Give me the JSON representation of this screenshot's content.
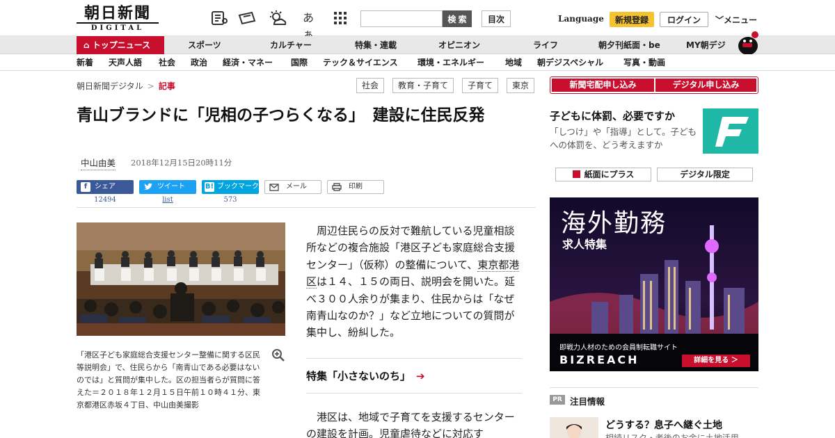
{
  "header": {
    "logo_main": "朝日新聞",
    "logo_sub": "DIGITAL",
    "font_size_label": "あぁ",
    "search_placeholder": "",
    "search_button": "検 索",
    "toc_button": "目次",
    "language": "Language",
    "register": "新規登録",
    "login": "ログイン",
    "menu": "メニュー"
  },
  "nav_main": [
    "トップニュース",
    "スポーツ",
    "カルチャー",
    "特集・連載",
    "オピニオン",
    "ライフ",
    "朝夕刊紙面・be",
    "MY朝デジ"
  ],
  "nav_sub": [
    "新着",
    "天声人語",
    "社会",
    "政治",
    "経済・マネー",
    "国際",
    "テック＆サイエンス",
    "環境・エネルギー",
    "地域",
    "朝デジスペシャル",
    "写真・動画"
  ],
  "breadcrumb": {
    "home": "朝日新聞デジタル",
    "sep": ">",
    "current": "記事"
  },
  "tags": [
    "社会",
    "教育・子育て",
    "子育て",
    "東京"
  ],
  "article": {
    "title": "青山ブランドに「児相の子つらくなる」　建設に住民反発",
    "author": "中山由美",
    "date": "2018年12月15日20時11分",
    "share": {
      "facebook": {
        "label": "シェア",
        "count": "12494"
      },
      "twitter": {
        "label": "ツイート",
        "count": "list"
      },
      "hatena": {
        "label": "ブックマーク",
        "count": "573"
      },
      "mail": "メール",
      "print": "印刷"
    },
    "caption": "「港区子ども家庭総合支援センター整備に関する区民等説明会」で、住民らから「南青山である必要はないのでは」と質問が集中した。区の担当者らが質問に答えた＝２０１８年１２月１５日午前１０時４１分、東京都港区赤坂４丁目、中山由美撮影",
    "para1_a": "周辺住民らの反対で難航している児童相談所などの複合施設「港区子ども家庭総合支援センター」（仮称）の整備について、",
    "para1_link": "東京都港区",
    "para1_b": "は１４、１５の両日、説明会を開いた。延べ３００人余りが集まり、住民からは「なぜ南青山なのか？」など立地についての質問が集中し、紛糾した。",
    "feature": "特集「小さないのち」",
    "para2_a": "港区は、地域で子育てを支援するセンターの建設を計画。",
    "para2_link": "児童虐待",
    "para2_b": "などに対応す"
  },
  "sidebar": {
    "subscribe_paper": "新聞宅配申し込み",
    "subscribe_digital": "デジタル申し込み",
    "promo_title": "子どもに体罰、必要ですか",
    "promo_desc": "「しつけ」や「指導」として。子どもへの体罰を、どう考えますか",
    "btn_plus": "紙面にプラス",
    "btn_limited": "デジタル限定",
    "ad_title": "海外勤務",
    "ad_sub": "求人特集",
    "ad_tag": "即戦力人材のための会員制転職サイト",
    "ad_logo": "BIZREACH",
    "ad_cta": "詳細を見る ＞",
    "pr_badge": "PR",
    "pr_section": "注目情報",
    "pr_headline": "どうする？息子へ継ぐ土地",
    "pr_desc": "相続リスク・老後のお金に土地活用"
  },
  "colors": {
    "accent": "#c8102e",
    "promo_bg": "#1fb8a7",
    "facebook": "#3b5998",
    "twitter": "#1da1f2",
    "hatena": "#00a4de"
  }
}
